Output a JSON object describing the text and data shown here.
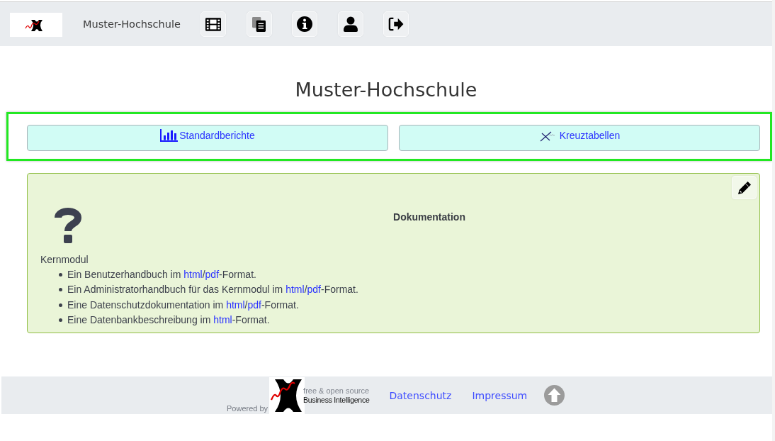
{
  "header": {
    "title": "Muster-Hochschule"
  },
  "page_title": "Muster-Hochschule",
  "nav_buttons": [
    {
      "kind": "reports",
      "label": "Standardberichte"
    },
    {
      "kind": "cube",
      "label": "Kreuztabellen"
    }
  ],
  "documentation": {
    "title": "Dokumentation",
    "section": "Kernmodul",
    "items": [
      {
        "segments": [
          {
            "kind": "text",
            "text": "Ein Benutzerhandbuch im "
          },
          {
            "kind": "link",
            "text": "html"
          },
          {
            "kind": "text",
            "text": "/"
          },
          {
            "kind": "link",
            "text": "pdf"
          },
          {
            "kind": "text",
            "text": "-Format."
          }
        ]
      },
      {
        "segments": [
          {
            "kind": "text",
            "text": "Ein Administratorhandbuch für das Kernmodul im "
          },
          {
            "kind": "link",
            "text": "html"
          },
          {
            "kind": "text",
            "text": "/"
          },
          {
            "kind": "link",
            "text": "pdf"
          },
          {
            "kind": "text",
            "text": "-Format."
          }
        ]
      },
      {
        "segments": [
          {
            "kind": "text",
            "text": "Eine Datenschutzdokumentation im "
          },
          {
            "kind": "link",
            "text": "html"
          },
          {
            "kind": "text",
            "text": "/"
          },
          {
            "kind": "link",
            "text": "pdf"
          },
          {
            "kind": "text",
            "text": "-Format."
          }
        ]
      },
      {
        "segments": [
          {
            "kind": "text",
            "text": "Eine Datenbankbeschreibung im "
          },
          {
            "kind": "link",
            "text": "html"
          },
          {
            "kind": "text",
            "text": "-Format."
          }
        ]
      }
    ]
  },
  "footer": {
    "powered_by": "Powered by",
    "tagline": [
      "free & open source",
      "Business Intelligence"
    ],
    "links": [
      "Datenschutz",
      "Impressum"
    ]
  }
}
